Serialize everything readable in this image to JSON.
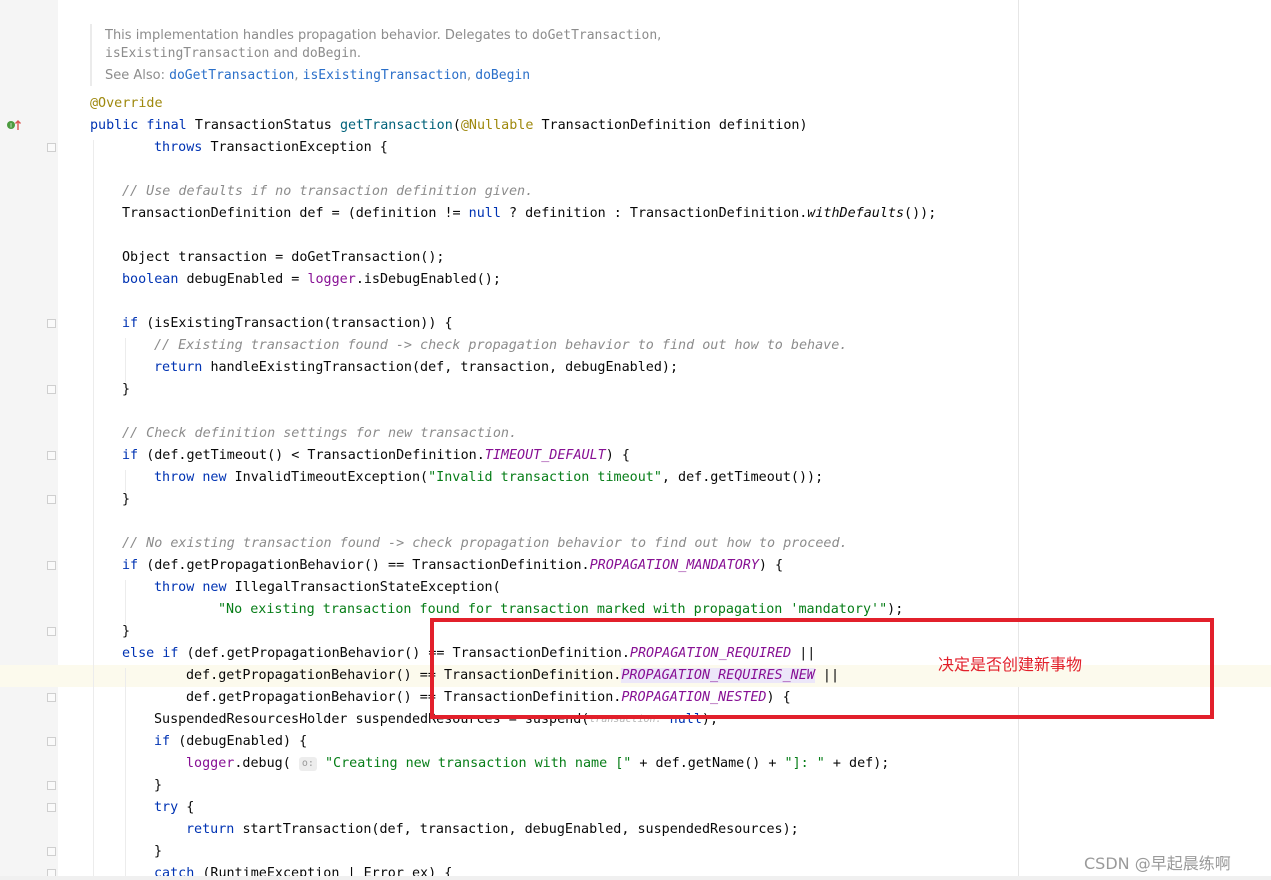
{
  "doc": {
    "line1_text": "This implementation handles propagation behavior. Delegates to ",
    "line1_code": "doGetTransaction",
    "line1_end": ",",
    "line2_code": "isExistingTransaction",
    "line2_mid": " and ",
    "line2_code2": "doBegin",
    "line2_end": ".",
    "see_also_label": "See Also: ",
    "see_also_links": [
      "doGetTransaction",
      "isExistingTransaction",
      "doBegin"
    ]
  },
  "code": {
    "l01": "@Override",
    "l02_kw": "public final ",
    "l02_a": "TransactionStatus ",
    "l02_b": "getTransaction",
    "l02_c": "(",
    "l02_an": "@Nullable",
    "l02_d": " TransactionDefinition definition)",
    "l03_kw": "throws ",
    "l03_a": "TransactionException {",
    "l04": "// Use defaults if no transaction definition given.",
    "l05_a": "TransactionDefinition def = (definition != ",
    "l05_kw": "null",
    "l05_b": " ? definition : TransactionDefinition.",
    "l05_it": "withDefaults",
    "l05_c": "());",
    "l06": "Object transaction = doGetTransaction();",
    "l07_kw": "boolean ",
    "l07_a": "debugEnabled = ",
    "l07_fl": "logger",
    "l07_b": ".isDebugEnabled();",
    "l08_kw": "if ",
    "l08_a": "(isExistingTransaction(transaction)) {",
    "l09": "// Existing transaction found -> check propagation behavior to find out how to behave.",
    "l10_kw": "return ",
    "l10_a": "handleExistingTransaction(def, transaction, debugEnabled);",
    "l11": "}",
    "l12": "// Check definition settings for new transaction.",
    "l13_kw": "if ",
    "l13_a": "(def.getTimeout() < TransactionDefinition.",
    "l13_sf": "TIMEOUT_DEFAULT",
    "l13_b": ") {",
    "l14_kw": "throw new ",
    "l14_a": "InvalidTimeoutException(",
    "l14_st": "\"Invalid transaction timeout\"",
    "l14_b": ", def.getTimeout());",
    "l15": "}",
    "l16": "// No existing transaction found -> check propagation behavior to find out how to proceed.",
    "l17_kw": "if ",
    "l17_a": "(def.getPropagationBehavior() == TransactionDefinition.",
    "l17_sf": "PROPAGATION_MANDATORY",
    "l17_b": ") {",
    "l18_kw": "throw new ",
    "l18_a": "IllegalTransactionStateException(",
    "l19_st": "\"No existing transaction found for transaction marked with propagation 'mandatory'\"",
    "l19_b": ");",
    "l20": "}",
    "l21_kw": "else if ",
    "l21_a": "(def.getPropagationBehavior() == TransactionDefinition.",
    "l21_sf": "PROPAGATION_REQUIRED",
    "l21_b": " ||",
    "l22_a": "def.getPropagationBehavior() == TransactionDefinition.",
    "l22_sf": "PROPAGATION_REQUIRES_NEW",
    "l22_b": " ||",
    "l23_a": "def.getPropagationBehavior() == TransactionDefinition.",
    "l23_sf": "PROPAGATION_NESTED",
    "l23_b": ") {",
    "l24_a": "SuspendedResourcesHolder suspendedResources = suspend(",
    "l24_hint": "transaction:",
    "l24_kw": " null",
    "l24_b": ");",
    "l25_kw": "if ",
    "l25_a": "(debugEnabled) {",
    "l26_fl": "logger",
    "l26_a": ".debug(",
    "l26_hint": "o:",
    "l26_st": "\"Creating new transaction with name [\"",
    "l26_b": " + def.getName() + ",
    "l26_st2": "\"]: \"",
    "l26_c": " + def);",
    "l27": "}",
    "l28_kw": "try ",
    "l28_a": "{",
    "l29_kw": "return ",
    "l29_a": "startTransaction(def, transaction, debugEnabled, suspendedResources);",
    "l30": "}",
    "l31_kw": "catch ",
    "l31_a": "(RuntimeException | Error ex) {"
  },
  "annotation": {
    "note": "决定是否创建新事物",
    "box_color": "#e2202b"
  },
  "watermark": "CSDN @早起晨练啊",
  "colors": {
    "keyword": "#0033b3",
    "annotation": "#9e880d",
    "comment": "#8c8c8c",
    "string": "#067d17",
    "static_field": "#871094",
    "doc_link": "#2a6fc9"
  }
}
